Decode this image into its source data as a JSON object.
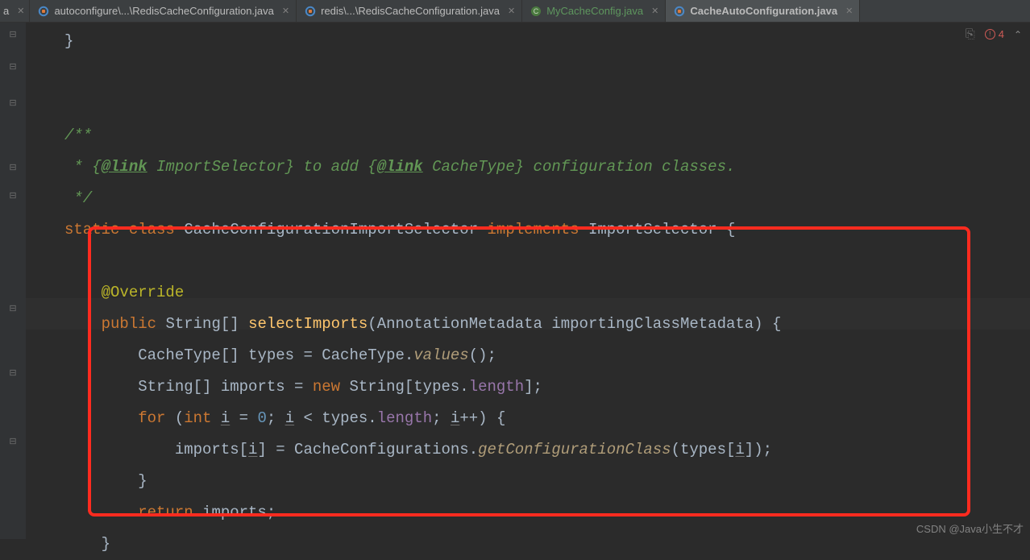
{
  "tabs": [
    {
      "label": "a",
      "type": "partial",
      "close": true,
      "active": false,
      "icon": "none"
    },
    {
      "label": "autoconfigure\\...\\RedisCacheConfiguration.java",
      "close": true,
      "active": false,
      "icon": "java"
    },
    {
      "label": "redis\\...\\RedisCacheConfiguration.java",
      "close": true,
      "active": false,
      "icon": "java"
    },
    {
      "label": "MyCacheConfig.java",
      "close": true,
      "active": false,
      "icon": "class",
      "green": true
    },
    {
      "label": "CacheAutoConfiguration.java",
      "close": true,
      "active": true,
      "icon": "java",
      "bold": true
    }
  ],
  "status": {
    "error_count": "4"
  },
  "watermark": "CSDN @Java小生不才",
  "code": {
    "l1": "}",
    "doc_open": "/**",
    "doc_mid_a": " * {",
    "doc_link1": "@link",
    "doc_mid_b": " ImportSelector} ",
    "doc_to": "to add ",
    "doc_mid_c": "{",
    "doc_link2": "@link",
    "doc_mid_d": " CacheType} ",
    "doc_rest": "configuration classes.",
    "doc_close": " */",
    "sig_static": "static ",
    "sig_class": "class ",
    "sig_name": "CacheConfigurationImportSelector ",
    "sig_impl": "implements ",
    "sig_iface": "ImportSelector {",
    "anno": "@Override",
    "m_public": "public ",
    "m_ret": "String[] ",
    "m_name": "selectImports",
    "m_params": "(AnnotationMetadata importingClassMetadata) {",
    "b1_a": "CacheType[] types = CacheType.",
    "b1_b": "values",
    "b1_c": "();",
    "b2_a": "String[] imports = ",
    "b2_new": "new ",
    "b2_b": "String[types.",
    "b2_len": "length",
    "b2_c": "];",
    "b3_for": "for ",
    "b3_a": "(",
    "b3_int": "int ",
    "b3_i": "i",
    "b3_b": " = ",
    "b3_zero": "0",
    "b3_c": "; ",
    "b3_i2": "i",
    "b3_d": " < types.",
    "b3_len": "length",
    "b3_e": "; ",
    "b3_i3": "i",
    "b3_f": "++) {",
    "b4_a": "imports[",
    "b4_i": "i",
    "b4_b": "] = CacheConfigurations.",
    "b4_call": "getConfigurationClass",
    "b4_c": "(types[",
    "b4_i2": "i",
    "b4_d": "]);",
    "b5": "}",
    "b6_ret": "return ",
    "b6_val": "imports;",
    "b7": "}"
  }
}
